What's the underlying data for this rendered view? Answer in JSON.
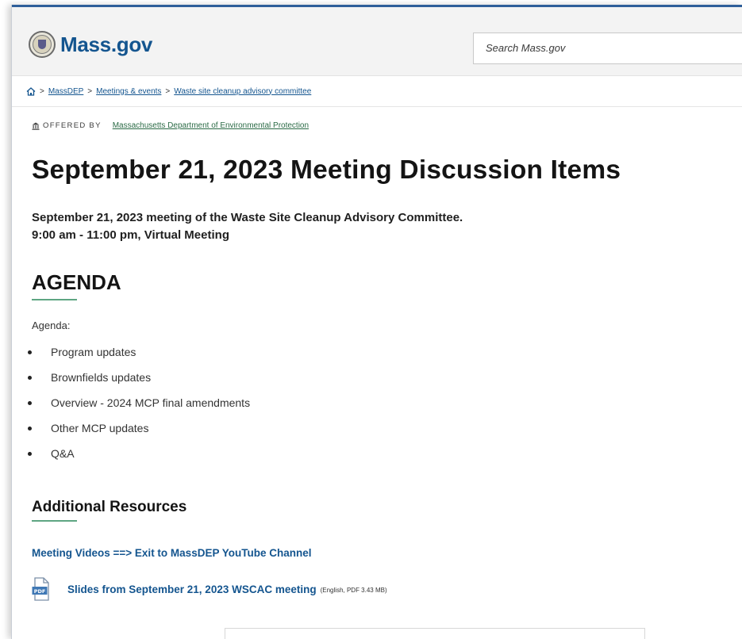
{
  "header": {
    "logo_text": "Mass.gov",
    "search_placeholder": "Search Mass.gov"
  },
  "breadcrumb": {
    "items": [
      "MassDEP",
      "Meetings & events",
      "Waste site cleanup advisory committee"
    ],
    "separator": ">"
  },
  "offered_by": {
    "label": "OFFERED BY",
    "org": "Massachusetts Department of Environmental Protection"
  },
  "page": {
    "title": "September 21, 2023 Meeting Discussion Items",
    "subtitle_line1": "September 21, 2023 meeting of the Waste Site Cleanup Advisory Committee.",
    "subtitle_line2": "9:00 am - 11:00 pm, Virtual Meeting"
  },
  "agenda": {
    "heading": "AGENDA",
    "intro": "Agenda:",
    "items": [
      "Program updates",
      "Brownfields updates",
      "Overview - 2024 MCP final amendments",
      "Other MCP updates",
      "Q&A"
    ]
  },
  "resources": {
    "heading": "Additional Resources",
    "video_link": "Meeting Videos ==> Exit to MassDEP YouTube Channel",
    "pdf_link": "Slides from September 21, 2023 WSCAC meeting",
    "pdf_meta": "(English, PDF 3.43 MB)",
    "pdf_icon_label": "PDF"
  },
  "colors": {
    "brand_blue": "#14558f",
    "accent_green": "#5ea682",
    "offered_link_green": "#2b6b46"
  }
}
